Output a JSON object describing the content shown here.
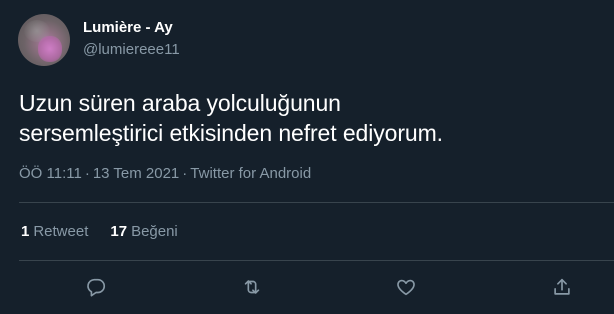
{
  "user": {
    "display_name": "Lumière - Ay",
    "handle": "@lumiereee11"
  },
  "tweet": {
    "lines": [
      "Uzun süren araba yolculuğunun",
      "sersemleştirici etkisinden nefret ediyorum."
    ]
  },
  "meta": {
    "time": "ÖÖ 11:11",
    "separator": "·",
    "date": "13 Tem 2021",
    "source": "Twitter for Android"
  },
  "stats": {
    "retweet_count": "1",
    "retweet_label": "Retweet",
    "like_count": "17",
    "like_label": "Beğeni"
  },
  "actions": {
    "icons": [
      "reply-icon",
      "retweet-icon",
      "like-icon",
      "share-icon"
    ]
  },
  "colors": {
    "background": "#15202b",
    "text": "#ffffff",
    "secondary": "#8899a6",
    "divider": "#38444d"
  }
}
